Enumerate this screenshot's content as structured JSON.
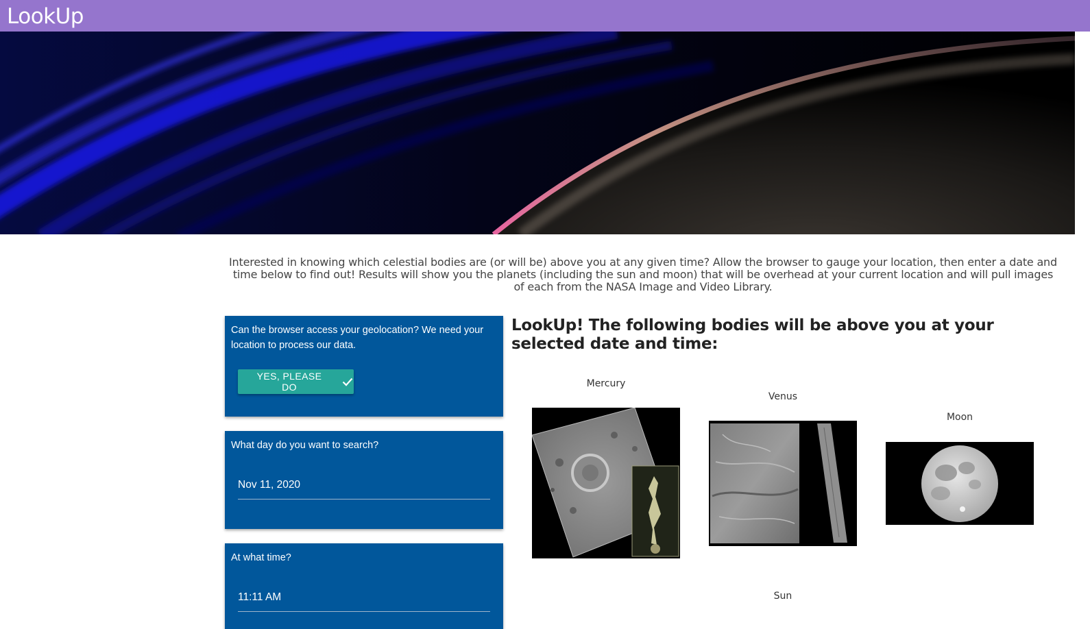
{
  "app": {
    "title": "LookUp"
  },
  "intro": "Interested in knowing which celestial bodies are (or will be) above you at any given time? Allow the browser to gauge your location, then enter a date and time below to find out! Results will show you the planets (including the sun and moon) that will be overhead at your current location and will pull images of each from the NASA Image and Video Library.",
  "geolocation": {
    "question": "Can the browser access your geolocation? We need your location to process our data.",
    "button_label": "YES, PLEASE DO",
    "button_icon": "check-icon"
  },
  "date": {
    "question": "What day do you want to search?",
    "value": "Nov 11, 2020"
  },
  "time": {
    "question": "At what time?",
    "value": "11:11 AM"
  },
  "results": {
    "heading": "LookUp! The following bodies will be above you at your selected date and time:",
    "bodies": [
      {
        "name": "Mercury"
      },
      {
        "name": "Venus"
      },
      {
        "name": "Moon"
      },
      {
        "name": "Sun"
      }
    ]
  },
  "colors": {
    "appbar": "#9575cd",
    "card": "#01579b",
    "button": "#26a69a"
  }
}
